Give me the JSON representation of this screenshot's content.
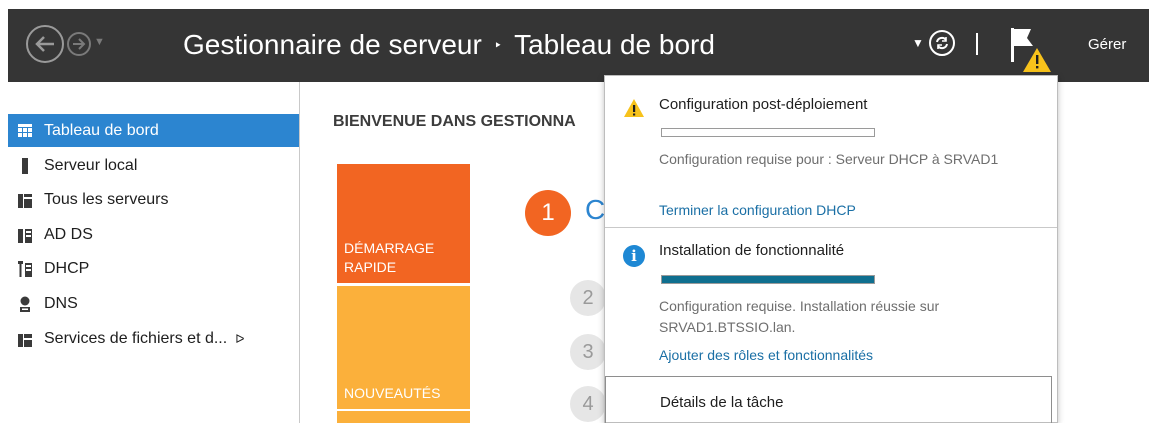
{
  "titlebar": {
    "app": "Gestionnaire de serveur",
    "separator": "‣",
    "page": "Tableau de bord",
    "manage": "Gérer"
  },
  "sidebar": {
    "items": [
      {
        "label": "Tableau de bord",
        "icon": "dashboard-icon",
        "active": true
      },
      {
        "label": "Serveur local",
        "icon": "local-server-icon"
      },
      {
        "label": "Tous les serveurs",
        "icon": "all-servers-icon"
      },
      {
        "label": "AD DS",
        "icon": "ad-ds-icon"
      },
      {
        "label": "DHCP",
        "icon": "dhcp-icon"
      },
      {
        "label": "DNS",
        "icon": "dns-icon"
      },
      {
        "label": "Services de fichiers et d...",
        "icon": "file-services-icon",
        "arrow": "ᐅ"
      }
    ]
  },
  "main": {
    "welcome": "BIENVENUE DANS GESTIONNA",
    "tiles": {
      "quick_start": "DÉMARRAGE RAPIDE",
      "whats_new": "NOUVEAUTÉS"
    },
    "steps": [
      "1",
      "2",
      "3",
      "4"
    ],
    "step1_text": "C"
  },
  "notifications": [
    {
      "icon": "warning-icon",
      "title": "Configuration post-déploiement",
      "progress": 0,
      "body": "Configuration requise pour : Serveur DHCP à SRVAD1",
      "link": "Terminer la configuration DHCP"
    },
    {
      "icon": "info-icon",
      "title": "Installation de fonctionnalité",
      "progress": 1,
      "body": "Configuration requise. Installation réussie sur SRVAD1.BTSSIO.lan.",
      "link": "Ajouter des rôles et fonctionnalités"
    }
  ],
  "task_details": "Détails de la tâche",
  "colors": {
    "titlebar": "#353535",
    "accent": "#2c85d0",
    "orange": "#f26522",
    "yellow": "#fbb03b",
    "progress": "#0f6f8f",
    "link": "#1a6fa5"
  }
}
